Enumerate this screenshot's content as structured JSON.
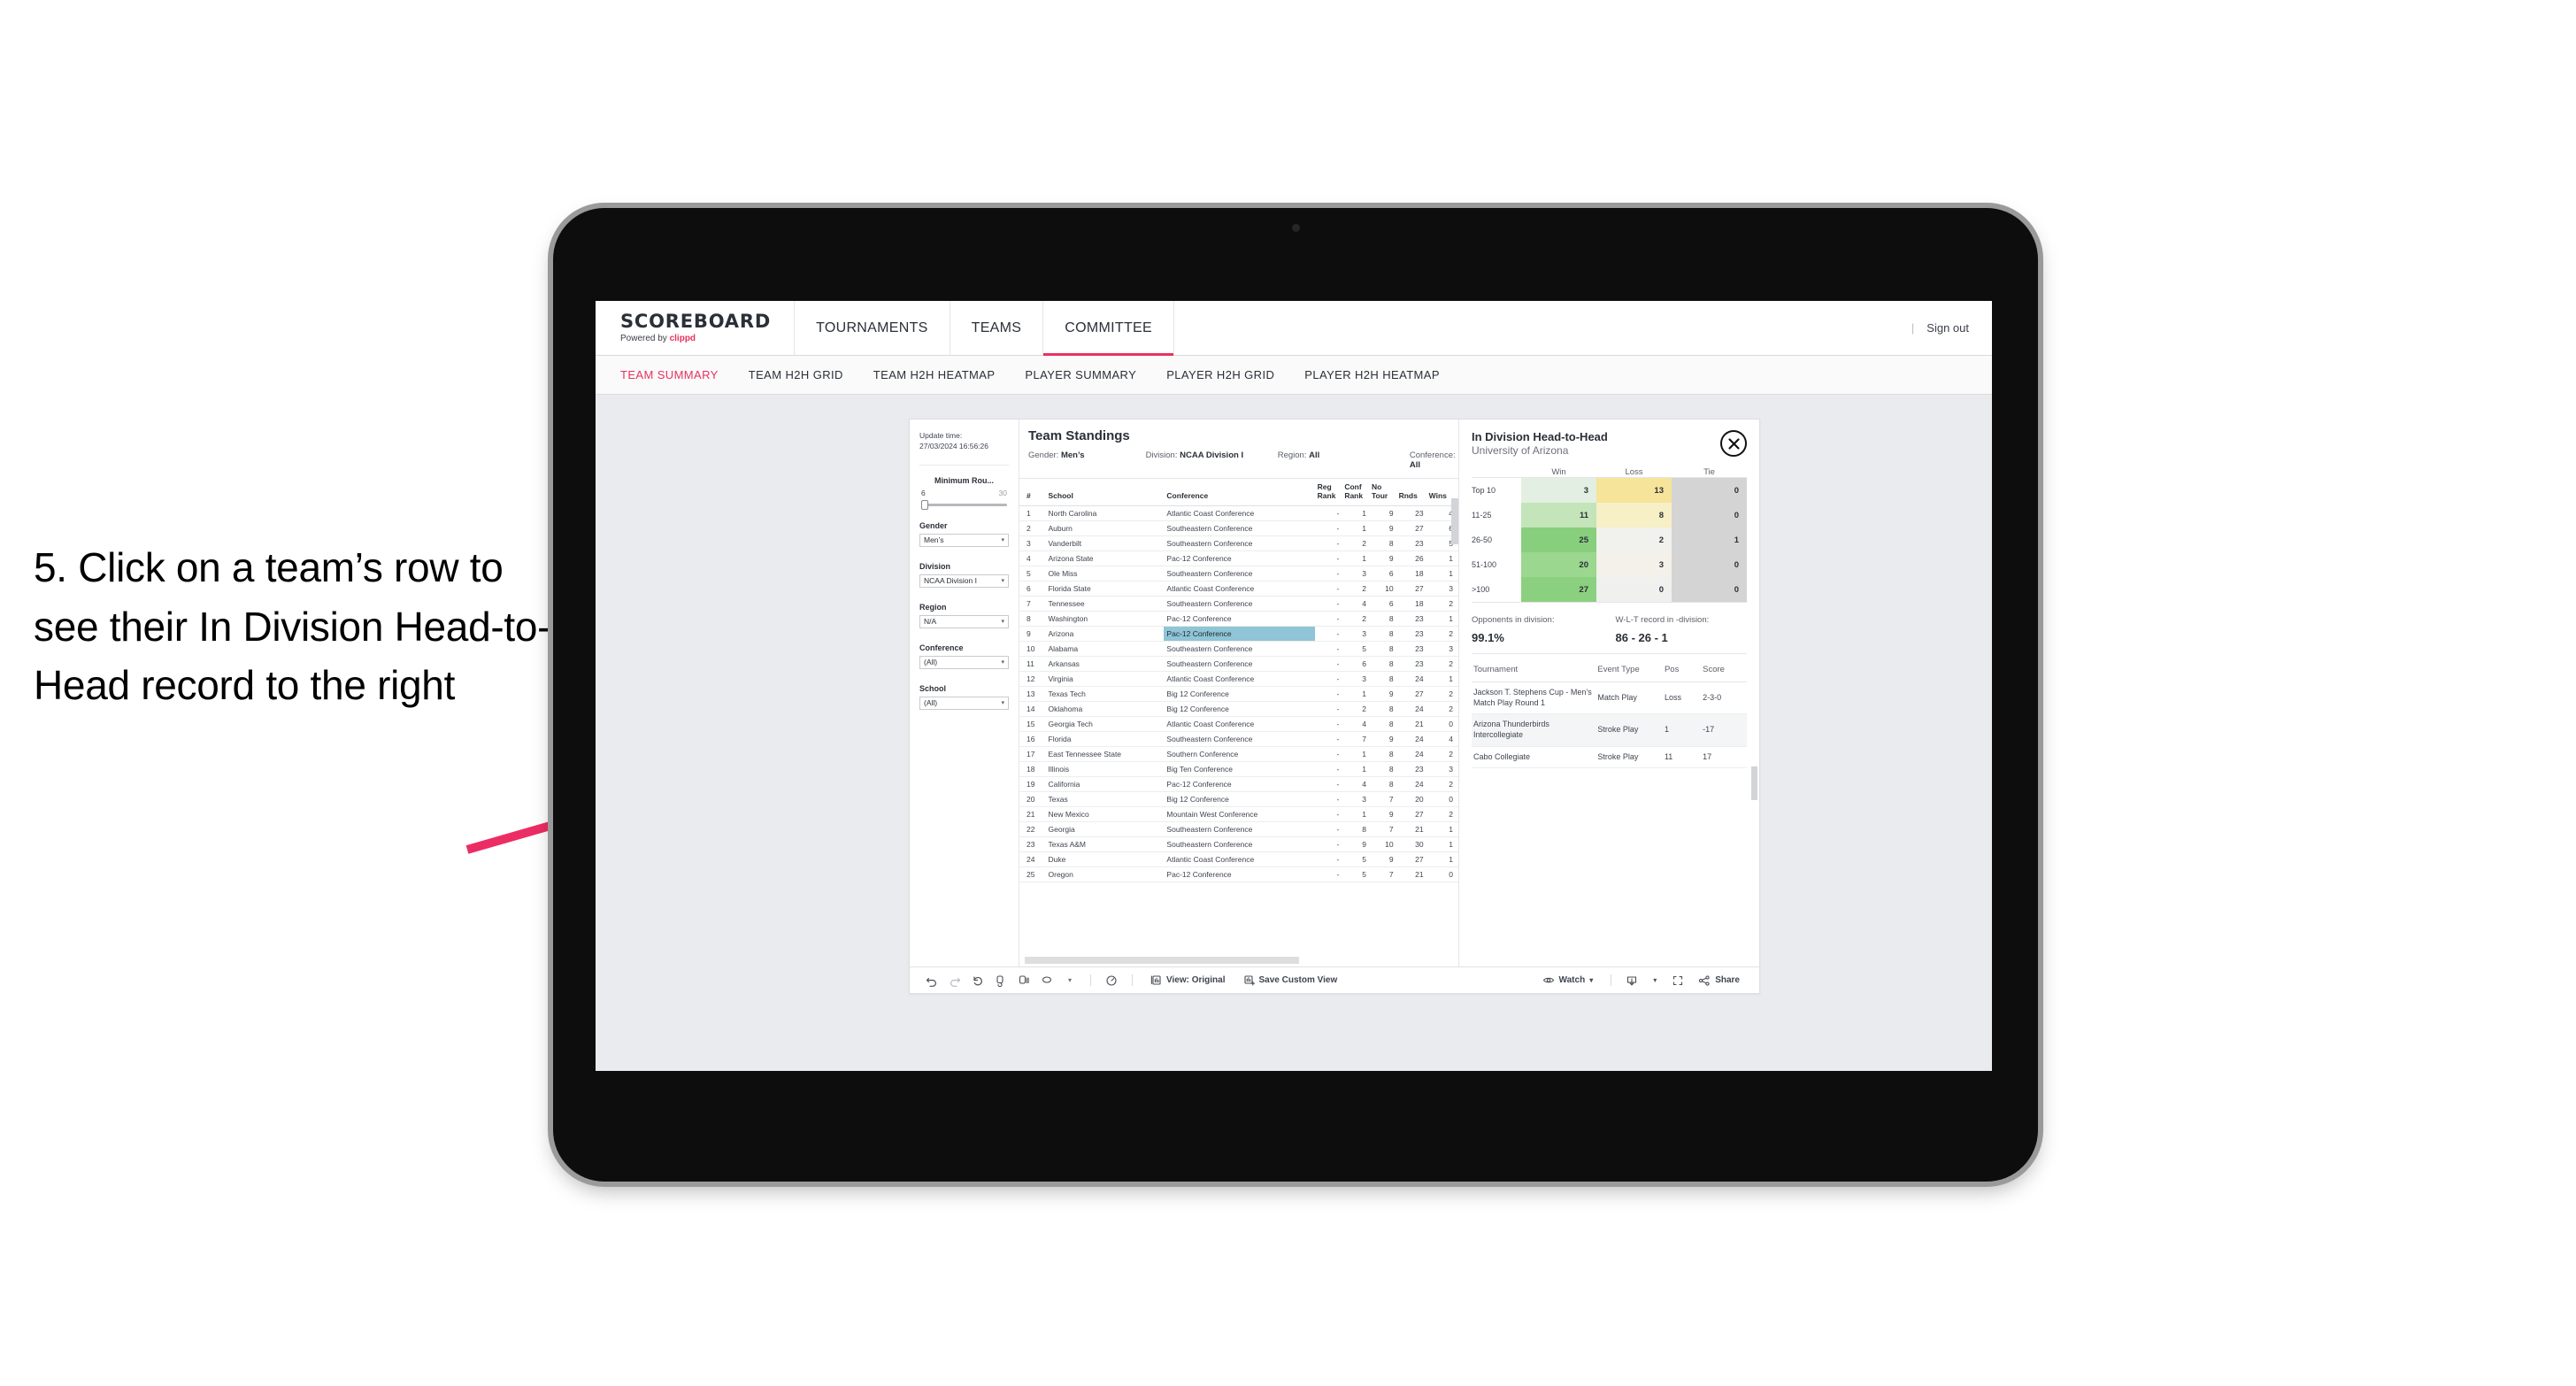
{
  "instruction": {
    "text": "5. Click on a team’s row to see their In Division Head-to-Head record to the right"
  },
  "header": {
    "brand_title": "SCOREBOARD",
    "brand_sub_prefix": "Powered by ",
    "brand_sub_name": "clippd",
    "nav": [
      {
        "label": "TOURNAMENTS",
        "active": false
      },
      {
        "label": "TEAMS",
        "active": false
      },
      {
        "label": "COMMITTEE",
        "active": true
      }
    ],
    "sign_out": "Sign out",
    "divider": "|"
  },
  "subnav": [
    {
      "label": "TEAM SUMMARY",
      "active": true
    },
    {
      "label": "TEAM H2H GRID",
      "active": false
    },
    {
      "label": "TEAM H2H HEATMAP",
      "active": false
    },
    {
      "label": "PLAYER SUMMARY",
      "active": false
    },
    {
      "label": "PLAYER H2H GRID",
      "active": false
    },
    {
      "label": "PLAYER H2H HEATMAP",
      "active": false
    }
  ],
  "filters": {
    "update_time_label": "Update time:",
    "update_time_value": "27/03/2024 16:56:26",
    "min_rounds": {
      "label": "Minimum Rou...",
      "min": "6",
      "max": "30"
    },
    "groups": [
      {
        "label": "Gender",
        "value": "Men’s"
      },
      {
        "label": "Division",
        "value": "NCAA Division I"
      },
      {
        "label": "Region",
        "value": "N/A"
      },
      {
        "label": "Conference",
        "value": "(All)"
      },
      {
        "label": "School",
        "value": "(All)"
      }
    ]
  },
  "standings": {
    "title": "Team Standings",
    "meta": [
      {
        "label": "Gender:",
        "value": "Men’s"
      },
      {
        "label": "Division:",
        "value": "NCAA Division I"
      },
      {
        "label": "Region:",
        "value": "All"
      },
      {
        "label": "Conference:",
        "value": "All"
      }
    ],
    "columns": [
      "#",
      "School",
      "Conference",
      "Reg Rank",
      "Conf Rank",
      "No Tour",
      "Rnds",
      "Wins"
    ],
    "rows": [
      {
        "n": "1",
        "school": "North Carolina",
        "conf": "Atlantic Coast Conference",
        "reg": "-",
        "cr": "1",
        "nt": "9",
        "rnds": "23",
        "wins": "4",
        "selected": false
      },
      {
        "n": "2",
        "school": "Auburn",
        "conf": "Southeastern Conference",
        "reg": "-",
        "cr": "1",
        "nt": "9",
        "rnds": "27",
        "wins": "6",
        "selected": false
      },
      {
        "n": "3",
        "school": "Vanderbilt",
        "conf": "Southeastern Conference",
        "reg": "-",
        "cr": "2",
        "nt": "8",
        "rnds": "23",
        "wins": "5",
        "selected": false
      },
      {
        "n": "4",
        "school": "Arizona State",
        "conf": "Pac-12 Conference",
        "reg": "-",
        "cr": "1",
        "nt": "9",
        "rnds": "26",
        "wins": "1",
        "selected": false
      },
      {
        "n": "5",
        "school": "Ole Miss",
        "conf": "Southeastern Conference",
        "reg": "-",
        "cr": "3",
        "nt": "6",
        "rnds": "18",
        "wins": "1",
        "selected": false
      },
      {
        "n": "6",
        "school": "Florida State",
        "conf": "Atlantic Coast Conference",
        "reg": "-",
        "cr": "2",
        "nt": "10",
        "rnds": "27",
        "wins": "3",
        "selected": false
      },
      {
        "n": "7",
        "school": "Tennessee",
        "conf": "Southeastern Conference",
        "reg": "-",
        "cr": "4",
        "nt": "6",
        "rnds": "18",
        "wins": "2",
        "selected": false
      },
      {
        "n": "8",
        "school": "Washington",
        "conf": "Pac-12 Conference",
        "reg": "-",
        "cr": "2",
        "nt": "8",
        "rnds": "23",
        "wins": "1",
        "selected": false
      },
      {
        "n": "9",
        "school": "Arizona",
        "conf": "Pac-12 Conference",
        "reg": "-",
        "cr": "3",
        "nt": "8",
        "rnds": "23",
        "wins": "2",
        "selected": true
      },
      {
        "n": "10",
        "school": "Alabama",
        "conf": "Southeastern Conference",
        "reg": "-",
        "cr": "5",
        "nt": "8",
        "rnds": "23",
        "wins": "3",
        "selected": false
      },
      {
        "n": "11",
        "school": "Arkansas",
        "conf": "Southeastern Conference",
        "reg": "-",
        "cr": "6",
        "nt": "8",
        "rnds": "23",
        "wins": "2",
        "selected": false
      },
      {
        "n": "12",
        "school": "Virginia",
        "conf": "Atlantic Coast Conference",
        "reg": "-",
        "cr": "3",
        "nt": "8",
        "rnds": "24",
        "wins": "1",
        "selected": false
      },
      {
        "n": "13",
        "school": "Texas Tech",
        "conf": "Big 12 Conference",
        "reg": "-",
        "cr": "1",
        "nt": "9",
        "rnds": "27",
        "wins": "2",
        "selected": false
      },
      {
        "n": "14",
        "school": "Oklahoma",
        "conf": "Big 12 Conference",
        "reg": "-",
        "cr": "2",
        "nt": "8",
        "rnds": "24",
        "wins": "2",
        "selected": false
      },
      {
        "n": "15",
        "school": "Georgia Tech",
        "conf": "Atlantic Coast Conference",
        "reg": "-",
        "cr": "4",
        "nt": "8",
        "rnds": "21",
        "wins": "0",
        "selected": false
      },
      {
        "n": "16",
        "school": "Florida",
        "conf": "Southeastern Conference",
        "reg": "-",
        "cr": "7",
        "nt": "9",
        "rnds": "24",
        "wins": "4",
        "selected": false
      },
      {
        "n": "17",
        "school": "East Tennessee State",
        "conf": "Southern Conference",
        "reg": "-",
        "cr": "1",
        "nt": "8",
        "rnds": "24",
        "wins": "2",
        "selected": false
      },
      {
        "n": "18",
        "school": "Illinois",
        "conf": "Big Ten Conference",
        "reg": "-",
        "cr": "1",
        "nt": "8",
        "rnds": "23",
        "wins": "3",
        "selected": false
      },
      {
        "n": "19",
        "school": "California",
        "conf": "Pac-12 Conference",
        "reg": "-",
        "cr": "4",
        "nt": "8",
        "rnds": "24",
        "wins": "2",
        "selected": false
      },
      {
        "n": "20",
        "school": "Texas",
        "conf": "Big 12 Conference",
        "reg": "-",
        "cr": "3",
        "nt": "7",
        "rnds": "20",
        "wins": "0",
        "selected": false
      },
      {
        "n": "21",
        "school": "New Mexico",
        "conf": "Mountain West Conference",
        "reg": "-",
        "cr": "1",
        "nt": "9",
        "rnds": "27",
        "wins": "2",
        "selected": false
      },
      {
        "n": "22",
        "school": "Georgia",
        "conf": "Southeastern Conference",
        "reg": "-",
        "cr": "8",
        "nt": "7",
        "rnds": "21",
        "wins": "1",
        "selected": false
      },
      {
        "n": "23",
        "school": "Texas A&M",
        "conf": "Southeastern Conference",
        "reg": "-",
        "cr": "9",
        "nt": "10",
        "rnds": "30",
        "wins": "1",
        "selected": false
      },
      {
        "n": "24",
        "school": "Duke",
        "conf": "Atlantic Coast Conference",
        "reg": "-",
        "cr": "5",
        "nt": "9",
        "rnds": "27",
        "wins": "1",
        "selected": false
      },
      {
        "n": "25",
        "school": "Oregon",
        "conf": "Pac-12 Conference",
        "reg": "-",
        "cr": "5",
        "nt": "7",
        "rnds": "21",
        "wins": "0",
        "selected": false
      }
    ]
  },
  "side_panel": {
    "title": "In Division Head-to-Head",
    "subtitle": "University of Arizona",
    "close_icon": "close-icon",
    "h2h": {
      "columns": [
        "Win",
        "Loss",
        "Tie"
      ],
      "rows": [
        {
          "band": "Top 10",
          "win": "3",
          "loss": "13",
          "tie": "0",
          "win_color": "#e3efe2",
          "loss_color": "#f5e49a",
          "tie_color": "#d4d4d4"
        },
        {
          "band": "11-25",
          "win": "11",
          "loss": "8",
          "tie": "0",
          "win_color": "#c3e5b9",
          "loss_color": "#f7efc6",
          "tie_color": "#d4d4d4"
        },
        {
          "band": "26-50",
          "win": "25",
          "loss": "2",
          "tie": "1",
          "win_color": "#88cf7d",
          "loss_color": "#f1f1ed",
          "tie_color": "#d4d4d4"
        },
        {
          "band": "51-100",
          "win": "20",
          "loss": "3",
          "tie": "0",
          "win_color": "#9bd78f",
          "loss_color": "#f3f1e9",
          "tie_color": "#d4d4d4"
        },
        {
          "band": ">100",
          "win": "27",
          "loss": "0",
          "tie": "0",
          "win_color": "#8bd07f",
          "loss_color": "#f0f0ef",
          "tie_color": "#d4d4d4"
        }
      ]
    },
    "stats": [
      {
        "label": "Opponents in division:",
        "value": "99.1%"
      },
      {
        "label": "W-L-T record in -division:",
        "value": "86 - 26 - 1"
      }
    ],
    "events": {
      "columns": [
        "Tournament",
        "Event Type",
        "Pos",
        "Score"
      ],
      "rows": [
        {
          "tournament": "Jackson T. Stephens Cup - Men’s Match Play Round 1",
          "type": "Match Play",
          "pos": "Loss",
          "score": "2-3-0"
        },
        {
          "tournament": "Arizona Thunderbirds Intercollegiate",
          "type": "Stroke Play",
          "pos": "1",
          "score": "-17"
        },
        {
          "tournament": "Cabo Collegiate",
          "type": "Stroke Play",
          "pos": "11",
          "score": "17"
        }
      ]
    }
  },
  "toolbar": {
    "icons": [
      "undo-icon",
      "redo-icon",
      "revert-icon",
      "refresh-data-icon",
      "pause-refresh-icon",
      "alerts-icon",
      "chevron-down-icon"
    ],
    "pause_caret": "▾",
    "view_label": "View: Original",
    "save_label": "Save Custom View",
    "watch_label": "Watch",
    "watch_caret": "▾",
    "download_caret": "▾",
    "share_label": "Share",
    "view_icon": "view-original-icon",
    "save_icon": "save-custom-view-icon",
    "watch_icon": "eye-icon",
    "download_icon": "download-icon",
    "fullscreen_icon": "fullscreen-icon",
    "share_icon": "share-icon",
    "separator": "|"
  },
  "colors": {
    "accent": "#e8315f",
    "selection": "#8fc5d6",
    "arrow": "#ec2d64"
  }
}
